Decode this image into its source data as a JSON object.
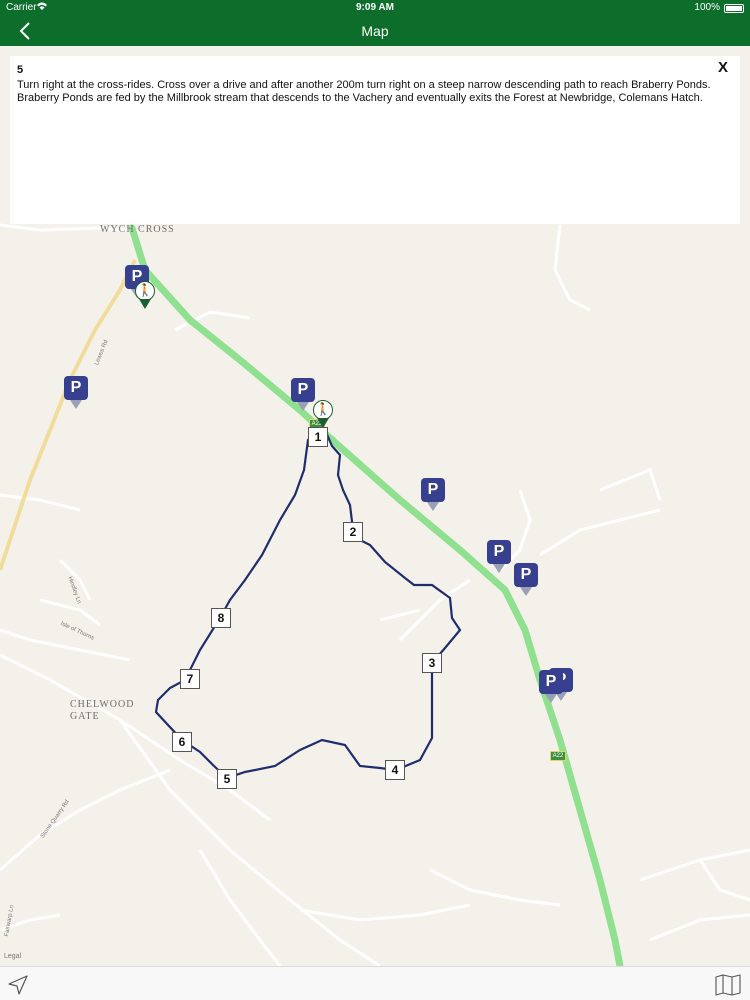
{
  "status_bar": {
    "carrier": "Carrier",
    "wifi_icon": "wifi-icon",
    "time": "9:09 AM",
    "battery_percent": "100%"
  },
  "nav": {
    "back_icon": "chevron-left-icon",
    "title": "Map"
  },
  "info_panel": {
    "step_number": "5",
    "close_label": "X",
    "text": "Turn right at the cross-rides. Cross over a drive and after another 200m turn right on a steep narrow descending path to reach Braberry Ponds. Braberry Ponds are fed by the Millbrook stream that descends to the Vachery and eventually exits the Forest at Newbridge, Colemans Hatch."
  },
  "map": {
    "place_labels": [
      "WYCH CROSS",
      "CHELWOOD GATE"
    ],
    "road_labels": [
      "Lewes Rd",
      "Hindley Ln",
      "Isle of Thorns",
      "Stone Quarry Rd",
      "Fairwarp Ln"
    ],
    "road_shields": [
      "A22",
      "A22"
    ],
    "parking_label": "P",
    "waypoints": [
      "1",
      "2",
      "3",
      "4",
      "5",
      "6",
      "7",
      "8"
    ],
    "legal_label": "Legal",
    "colors": {
      "route": "#1f2d6e",
      "main_road": "#8fe08f",
      "parking": "#373f8f",
      "header": "#0d6e2c"
    }
  },
  "bottom_bar": {
    "locate_icon": "location-arrow-icon",
    "map_icon": "folded-map-icon"
  }
}
